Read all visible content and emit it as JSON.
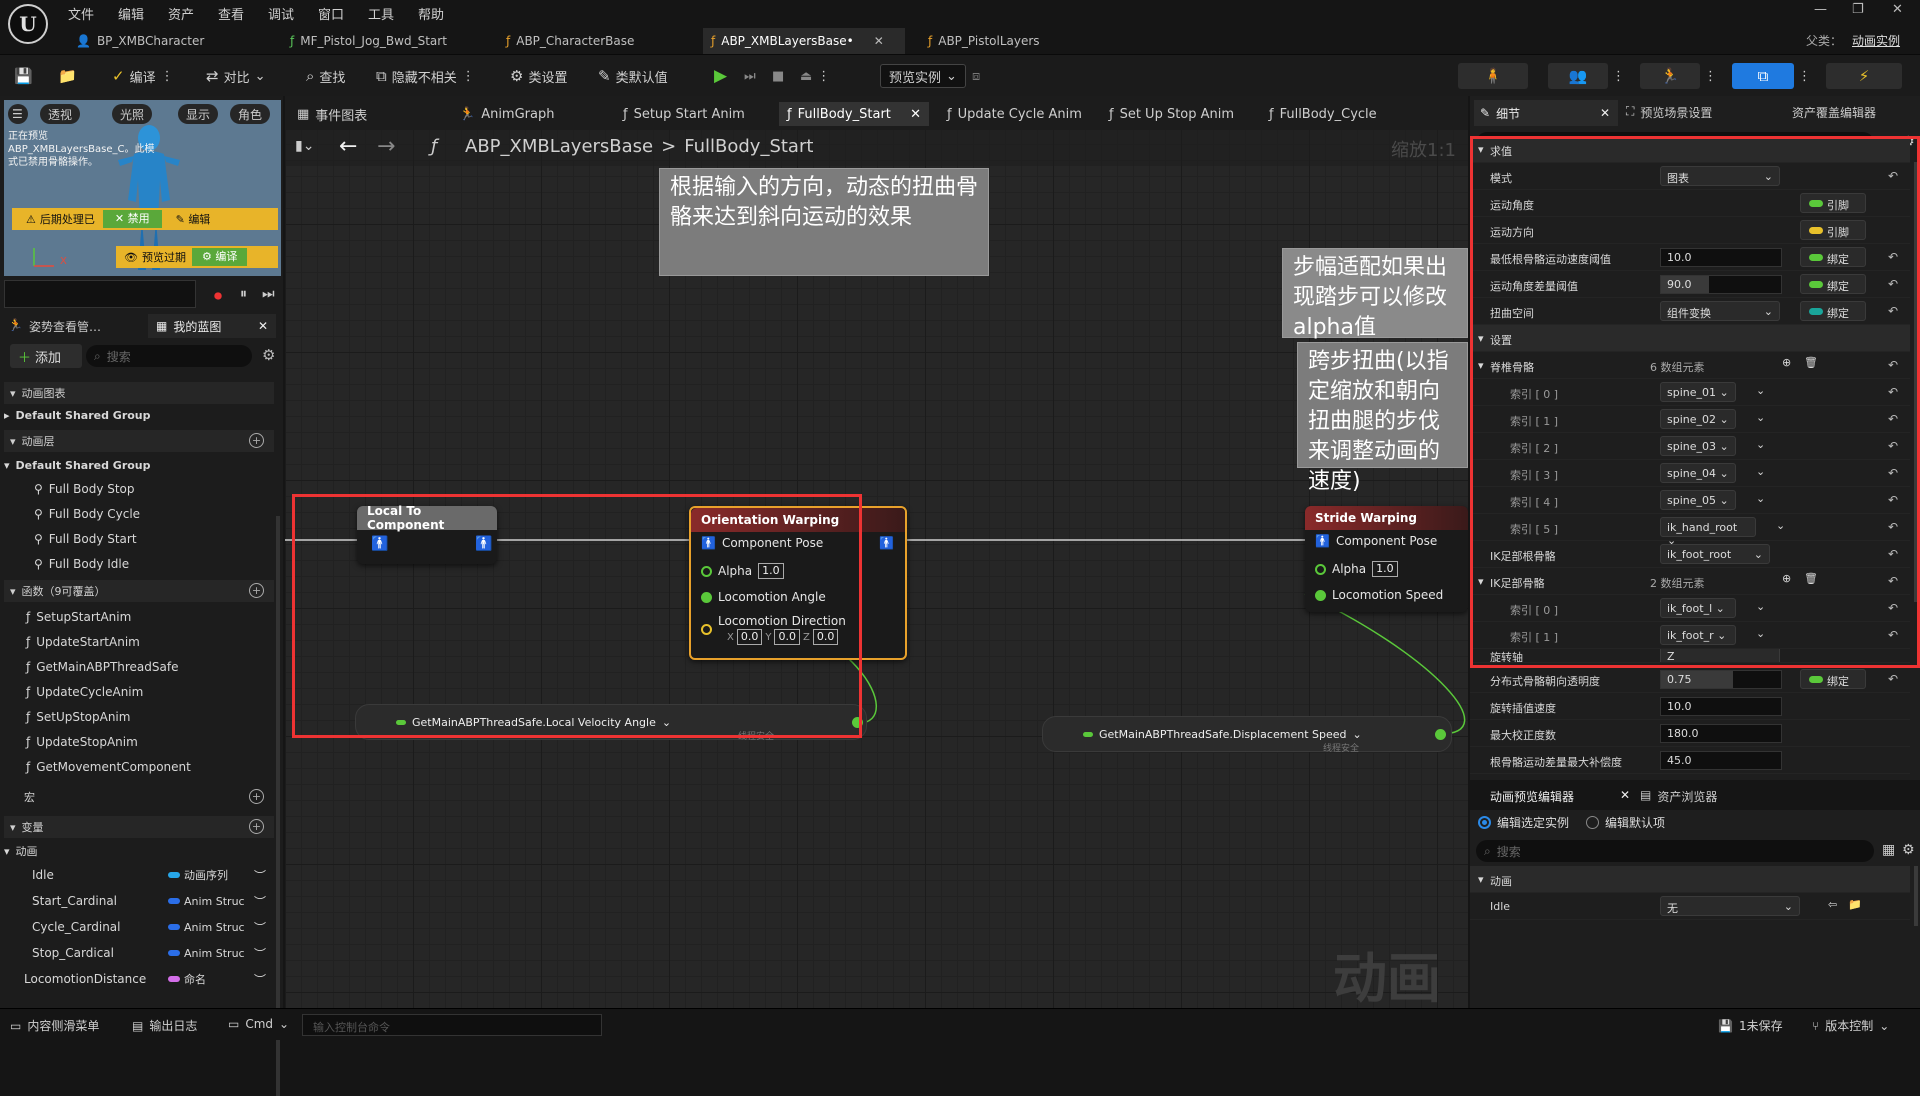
{
  "menu": [
    "文件",
    "编辑",
    "资产",
    "查看",
    "调试",
    "窗口",
    "工具",
    "帮助"
  ],
  "doc_tabs": [
    {
      "label": "BP_XMBCharacter"
    },
    {
      "label": "MF_Pistol_Jog_Bwd_Start"
    },
    {
      "label": "ABP_CharacterBase"
    },
    {
      "label": "ABP_XMBLayersBase•"
    },
    {
      "label": "ABP_PistolLayers"
    }
  ],
  "parent_class": {
    "label": "父类：",
    "value": "动画实例"
  },
  "toolbar": {
    "compile": "编译",
    "diff": "对比",
    "find": "查找",
    "hide_unrelated": "隐藏不相关",
    "class_settings": "类设置",
    "class_defaults": "类默认值",
    "preview_instance": "预览实例"
  },
  "viewport": {
    "pills": [
      "透视",
      "光照",
      "显示",
      "角色"
    ],
    "warning": "正在预览ABP_XMBLayersBase_C。此模式已禁用骨骼操作。",
    "post_process": "后期处理已",
    "disable": "禁用",
    "edit": "编辑",
    "preview_overflow": "预览过期",
    "compile": "编译"
  },
  "left_panel": {
    "tab1": "姿势查看管…",
    "tab2": "我的蓝图",
    "add": "添加",
    "search_placeholder": "搜索",
    "anim_graph_header": "动画图表",
    "default_group": "Default Shared Group",
    "anim_layers_header": "动画层",
    "layer_group": "Default Shared Group",
    "layers": [
      "Full Body Stop",
      "Full Body Cycle",
      "Full Body Start",
      "Full Body Idle"
    ],
    "functions_header": "函数（9可覆盖）",
    "functions": [
      "SetupStartAnim",
      "UpdateStartAnim",
      "GetMainABPThreadSafe",
      "UpdateCycleAnim",
      "SetUpStopAnim",
      "UpdateStopAnim",
      "GetMovementComponent"
    ],
    "macros_header": "宏",
    "variables_header": "变量",
    "anim_category": "动画",
    "variables": [
      {
        "name": "Idle",
        "type": "动画序列",
        "color": "#27a6e8"
      },
      {
        "name": "Start_Cardinal",
        "type": "Anim Struc",
        "color": "#2b6ee8"
      },
      {
        "name": "Cycle_Cardinal",
        "type": "Anim Struc",
        "color": "#2b6ee8"
      },
      {
        "name": "Stop_Cardical",
        "type": "Anim Struc",
        "color": "#2b6ee8"
      },
      {
        "name": "LocomotionDistance",
        "type": "命名",
        "color": "#d36ee8"
      }
    ]
  },
  "graph": {
    "tabs": [
      {
        "label": "事件图表"
      },
      {
        "label": "AnimGraph"
      },
      {
        "label": "Setup Start Anim"
      },
      {
        "label": "FullBody_Start"
      },
      {
        "label": "Update Cycle Anim"
      },
      {
        "label": "Set Up Stop Anim"
      },
      {
        "label": "FullBody_Cycle"
      }
    ],
    "breadcrumb_root": "ABP_XMBLayersBase",
    "breadcrumb_sep": ">",
    "breadcrumb_leaf": "FullBody_Start",
    "zoom": "缩放1:1",
    "comment1": "根据输入的方向，动态的扭曲骨骼来达到斜向运动的效果",
    "comment2": "步幅适配如果出现踏步可以修改alpha值",
    "comment3": "跨步扭曲(以指定缩放和朝向扭曲腿的步伐来调整动画的速度)",
    "watermark": "动画",
    "node_ltc": {
      "title": "Local To Component"
    },
    "node_ow": {
      "title": "Orientation Warping",
      "pose": "Component Pose",
      "alpha": "Alpha",
      "alpha_val": "1.0",
      "angle": "Locomotion Angle",
      "direction": "Locomotion Direction",
      "x": "X",
      "y": "Y",
      "z": "Z",
      "xv": "0.0",
      "yv": "0.0",
      "zv": "0.0"
    },
    "node_sw": {
      "title": "Stride Warping",
      "pose": "Component Pose",
      "alpha": "Alpha",
      "alpha_val": "1.0",
      "speed": "Locomotion Speed"
    },
    "getter1": {
      "label": "GetMainABPThreadSafe.Local Velocity Angle",
      "tag": "线程安全"
    },
    "getter2": {
      "label": "GetMainABPThreadSafe.Displacement Speed",
      "tag": "线程安全"
    }
  },
  "details": {
    "tab_details": "细节",
    "tab_preview": "预览场景设置",
    "tab_override": "资产覆盖编辑器",
    "search_placeholder": "搜索",
    "section_eval": "求值",
    "section_settings": "设置",
    "mode_label": "模式",
    "mode_value": "图表",
    "angle_label": "运动角度",
    "angle_bind": "引脚",
    "dir_label": "运动方向",
    "dir_bind": "引脚",
    "min_speed_label": "最低根骨骼运动速度阈值",
    "min_speed_val": "10.0",
    "min_speed_bind": "绑定",
    "angle_delta_label": "运动角度差量阈值",
    "angle_delta_val": "90.0",
    "angle_delta_bind": "绑定",
    "space_label": "扭曲空间",
    "space_val": "组件变换",
    "space_bind": "绑定",
    "spine_label": "脊椎骨骼",
    "spine_count": "6 数组元素",
    "spine_items": [
      {
        "idx": "索引 [ 0 ]",
        "val": "spine_01"
      },
      {
        "idx": "索引 [ 1 ]",
        "val": "spine_02"
      },
      {
        "idx": "索引 [ 2 ]",
        "val": "spine_03"
      },
      {
        "idx": "索引 [ 3 ]",
        "val": "spine_04"
      },
      {
        "idx": "索引 [ 4 ]",
        "val": "spine_05"
      },
      {
        "idx": "索引 [ 5 ]",
        "val": "ik_hand_root"
      }
    ],
    "ik_root_label": "IK足部根骨骼",
    "ik_root_val": "ik_foot_root",
    "ik_feet_label": "IK足部骨骼",
    "ik_feet_count": "2 数组元素",
    "ik_items": [
      {
        "idx": "索引 [ 0 ]",
        "val": "ik_foot_l"
      },
      {
        "idx": "索引 [ 1 ]",
        "val": "ik_foot_r"
      }
    ],
    "rot_axis_label": "旋转轴",
    "rot_axis_val": "Z",
    "dist_label": "分布式骨骼朝向透明度",
    "dist_val": "0.75",
    "dist_bind": "绑定",
    "interp_label": "旋转插值速度",
    "interp_val": "10.0",
    "max_corr_label": "最大校正度数",
    "max_corr_val": "180.0",
    "root_max_label": "根骨骼运动差量最大补偿度",
    "root_max_val": "45.0"
  },
  "anim_preview": {
    "tab": "动画预览编辑器",
    "tab2": "资产浏览器",
    "radio1": "编辑选定实例",
    "radio2": "编辑默认项",
    "search_placeholder": "搜索",
    "category": "动画",
    "idle_label": "Idle",
    "idle_value": "无"
  },
  "statusbar": {
    "content_drawer": "内容侧滑菜单",
    "output_log": "输出日志",
    "cmd": "Cmd",
    "cmd_placeholder": "输入控制台命令",
    "unsaved": "1未保存",
    "source_control": "版本控制"
  }
}
